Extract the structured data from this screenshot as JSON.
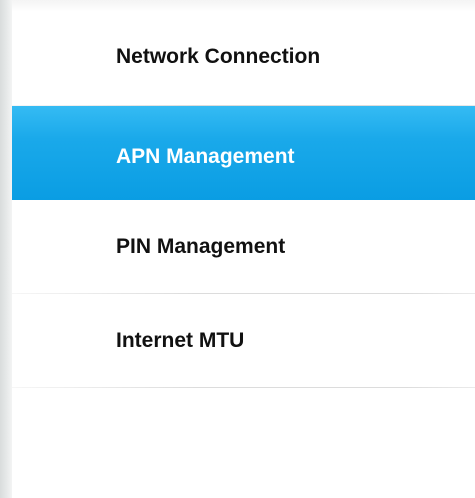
{
  "menu": {
    "items": [
      {
        "label": "Network Connection",
        "active": false
      },
      {
        "label": "APN Management",
        "active": true
      },
      {
        "label": "PIN Management",
        "active": false
      },
      {
        "label": "Internet MTU",
        "active": false
      }
    ]
  },
  "colors": {
    "active_background": "#1aa9ea",
    "active_text": "#ffffff",
    "text": "#111111",
    "divider": "#dcdcdc"
  }
}
